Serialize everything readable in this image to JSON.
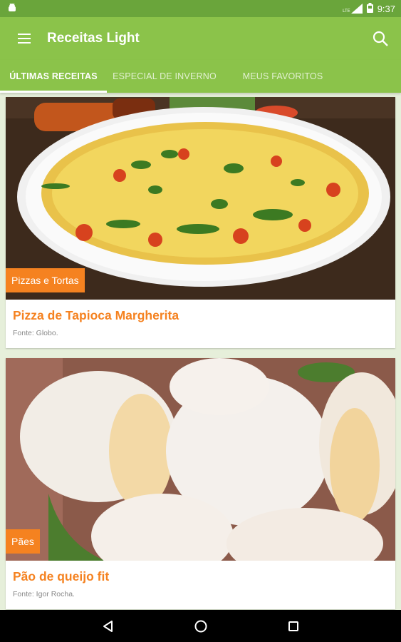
{
  "status_bar": {
    "notification_icon": "android-icon",
    "network_label": "LTE",
    "time": "9:37"
  },
  "app_bar": {
    "title": "Receitas Light",
    "menu_icon": "hamburger-menu-icon",
    "search_icon": "search-icon"
  },
  "tabs": [
    {
      "label": "ÚLTIMAS RECEITAS",
      "active": true
    },
    {
      "label": "ESPECIAL DE INVERNO",
      "active": false
    },
    {
      "label": "MEUS FAVORITOS",
      "active": false
    }
  ],
  "recipes": [
    {
      "category": "Pizzas e Tortas",
      "title": "Pizza de Tapioca Margherita",
      "source": "Fonte: Globo."
    },
    {
      "category": "Pães",
      "title": "Pão de queijo fit",
      "source": "Fonte: Igor Rocha."
    }
  ],
  "colors": {
    "primary": "#8bc34a",
    "primary_dark": "#6aa53b",
    "accent": "#f58220"
  },
  "nav_bar": {
    "back_icon": "back-triangle-icon",
    "home_icon": "home-circle-icon",
    "recents_icon": "recents-square-icon"
  }
}
